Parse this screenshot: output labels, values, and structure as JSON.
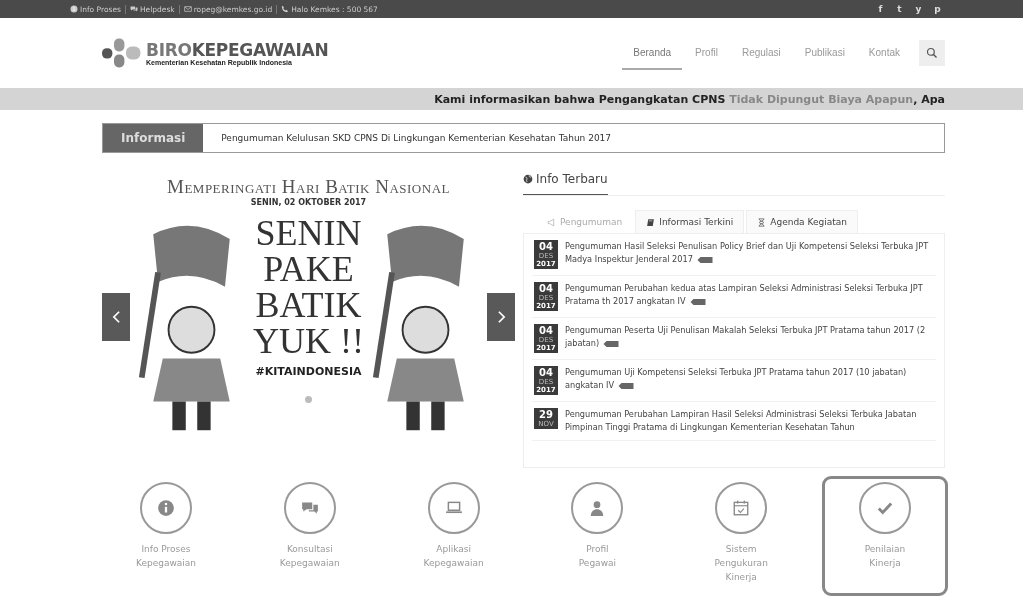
{
  "top_bar": {
    "links": [
      {
        "kind": "info",
        "label": "Info Proses"
      },
      {
        "kind": "chat",
        "label": "Helpdesk"
      },
      {
        "kind": "mail",
        "label": "ropeg@kemkes.go.id"
      },
      {
        "kind": "phone",
        "label": "Halo Kemkes : 500 567"
      }
    ],
    "social": [
      "f",
      "t",
      "y",
      "p"
    ]
  },
  "logo": {
    "title_part1": "BIRO",
    "title_part2": "KEPEGAWAIAN",
    "subtitle": "Kementerian Kesehatan Republik Indonesia"
  },
  "nav": [
    {
      "label": "Beranda",
      "selected": true
    },
    {
      "label": "Profil",
      "selected": false
    },
    {
      "label": "Regulasi",
      "selected": false
    },
    {
      "label": "Publikasi",
      "selected": false
    },
    {
      "label": "Kontak",
      "selected": false
    }
  ],
  "marquee": "Kami informasikan bahwa Pengangkatan CPNS **Tidak Dipungut Biaya Apapun**, Apa",
  "info_bar": {
    "label": "Informasi",
    "text": "Pengumuman Kelulusan SKD CPNS Di Lingkungan Kementerian Kesehatan Tahun 2017"
  },
  "banner": {
    "title": "Memperingati Hari Batik Nasional",
    "date": "SENIN, 02 OKTOBER 2017",
    "slogan": [
      "SENIN",
      "PAKE",
      "BATIK",
      "YUK !!"
    ],
    "hashtag": "#KITAINDONESIA"
  },
  "info_terbaru": {
    "heading": "Info Terbaru",
    "tabs": [
      {
        "kind": "megaphone",
        "label": "Pengumuman",
        "selected": true
      },
      {
        "kind": "book",
        "label": "Informasi Terkini",
        "selected": false
      },
      {
        "kind": "hourglass",
        "label": "Agenda Kegiatan",
        "selected": false
      }
    ],
    "items": [
      {
        "day": "04",
        "month": "DES",
        "year": "2017",
        "text": "Pengumuman Hasil Seleksi Penulisan Policy Brief dan Uji Kompetensi Seleksi Terbuka JPT Madya Inspektur Jenderal 2017",
        "new": true
      },
      {
        "day": "04",
        "month": "DES",
        "year": "2017",
        "text": "Pengumuman Perubahan kedua atas Lampiran Seleksi Administrasi Seleksi Terbuka JPT Pratama th 2017 angkatan IV",
        "new": true
      },
      {
        "day": "04",
        "month": "DES",
        "year": "2017",
        "text": "Pengumuman Peserta Uji Penulisan Makalah Seleksi Terbuka JPT Pratama tahun 2017 (2 jabatan)",
        "new": true
      },
      {
        "day": "04",
        "month": "DES",
        "year": "2017",
        "text": "Pengumuman Uji Kompetensi Seleksi Terbuka JPT Pratama tahun 2017 (10 jabatan) angkatan IV",
        "new": true
      },
      {
        "day": "29",
        "month": "NOV",
        "text": "Pengumuman Perubahan Lampiran Hasil Seleksi Administrasi Seleksi Terbuka Jabatan Pimpinan Tinggi Pratama di Lingkungan Kementerian Kesehatan Tahun",
        "new": false
      }
    ]
  },
  "tiles": [
    {
      "kind": "info",
      "lines": [
        "Info Proses",
        "Kepegawaian"
      ],
      "selected": false
    },
    {
      "kind": "chat",
      "lines": [
        "Konsultasi",
        "Kepegawaian"
      ],
      "selected": false
    },
    {
      "kind": "laptop",
      "lines": [
        "Aplikasi",
        "Kepegawaian"
      ],
      "selected": false
    },
    {
      "kind": "user",
      "lines": [
        "Profil",
        "Pegawai"
      ],
      "selected": false
    },
    {
      "kind": "calendar",
      "lines": [
        "Sistem",
        "Pengukuran",
        "Kinerja"
      ],
      "selected": false
    },
    {
      "kind": "check",
      "lines": [
        "Penilaian",
        "Kinerja"
      ],
      "selected": true
    }
  ]
}
